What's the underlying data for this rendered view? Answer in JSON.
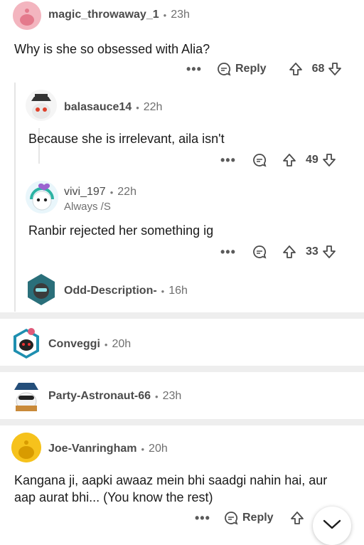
{
  "comments": [
    {
      "user": "magic_throwaway_1",
      "time": "23h",
      "text": "Why is she so obsessed with Alia?",
      "reply_label": "Reply",
      "votes": "68"
    },
    {
      "user": "balasauce14",
      "time": "22h",
      "text": "Because she is irrelevant, aila isn't",
      "votes": "49"
    },
    {
      "user": "vivi_197",
      "time": "22h",
      "flair": "Always /S",
      "text": "Ranbir rejected her something ig",
      "votes": "33"
    },
    {
      "user": "Odd-Description-",
      "time": "16h"
    },
    {
      "user": "Conveggi",
      "time": "20h"
    },
    {
      "user": "Party-Astronaut-66",
      "time": "23h"
    },
    {
      "user": "Joe-Vanringham",
      "time": "20h",
      "text": "Kangana ji, aapki awaaz mein bhi saadgi nahin hai, aur aap aurat bhi... (You know the rest)",
      "reply_label": "Reply"
    }
  ],
  "ui": {
    "more": "•••",
    "separator_dot": "•"
  },
  "colors": {
    "background": "#ffffff",
    "separator": "#eeeeee",
    "text": "#1a1a1a",
    "muted": "#6f6f6f"
  }
}
